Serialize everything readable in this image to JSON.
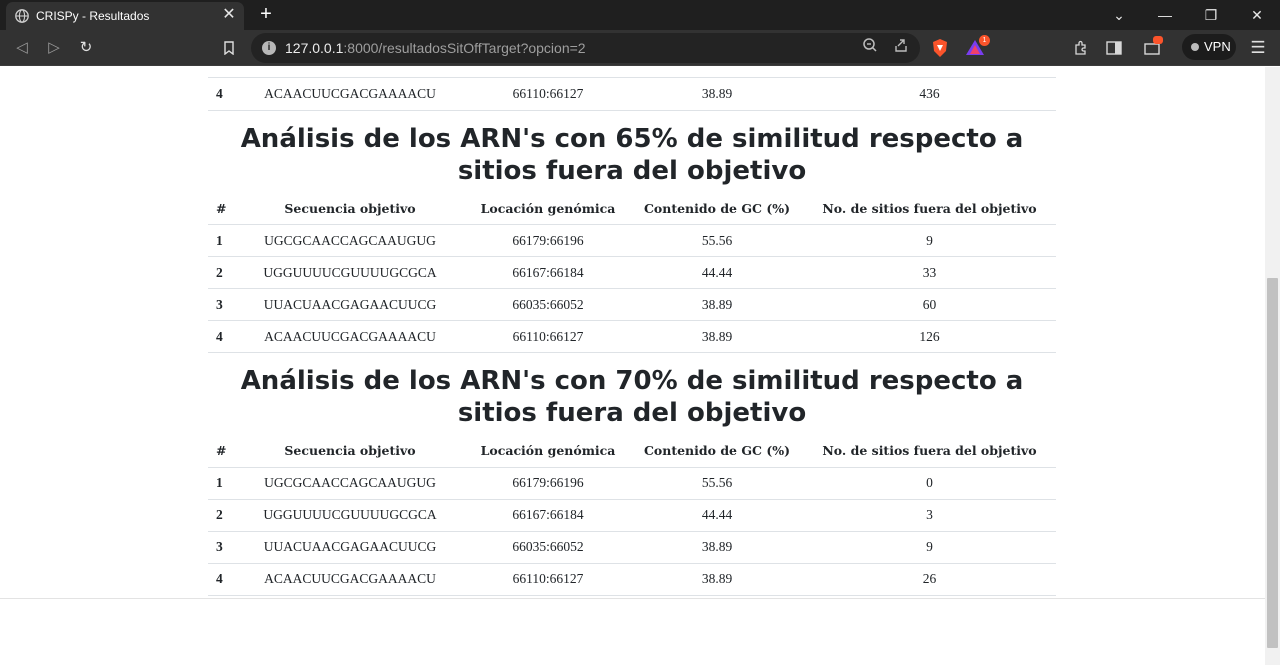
{
  "browser": {
    "tab_title": "CRISPy - Resultados",
    "url_host": "127.0.0.1",
    "url_rest": ":8000/resultadosSitOffTarget?opcion=2",
    "vpn_label": "VPN",
    "brave_alert_count": "1"
  },
  "table_headers": {
    "num": "#",
    "seq": "Secuencia objetivo",
    "loc": "Locación genómica",
    "gc": "Contenido de GC (%)",
    "sites": "No. de sitios fuera del objetivo"
  },
  "partial_row": {
    "num": "4",
    "seq": "ACAACUUCGACGAAAACU",
    "loc": "66110:66127",
    "gc": "38.89",
    "sites": "436"
  },
  "sections": [
    {
      "title": "Análisis de los ARN's con 65% de similitud respecto a sitios fuera del objetivo",
      "rows": [
        {
          "num": "1",
          "seq": "UGCGCAACCAGCAAUGUG",
          "loc": "66179:66196",
          "gc": "55.56",
          "sites": "9"
        },
        {
          "num": "2",
          "seq": "UGGUUUUCGUUUUGCGCA",
          "loc": "66167:66184",
          "gc": "44.44",
          "sites": "33"
        },
        {
          "num": "3",
          "seq": "UUACUAACGAGAACUUCG",
          "loc": "66035:66052",
          "gc": "38.89",
          "sites": "60"
        },
        {
          "num": "4",
          "seq": "ACAACUUCGACGAAAACU",
          "loc": "66110:66127",
          "gc": "38.89",
          "sites": "126"
        }
      ]
    },
    {
      "title": "Análisis de los ARN's con 70% de similitud respecto a sitios fuera del objetivo",
      "rows": [
        {
          "num": "1",
          "seq": "UGCGCAACCAGCAAUGUG",
          "loc": "66179:66196",
          "gc": "55.56",
          "sites": "0"
        },
        {
          "num": "2",
          "seq": "UGGUUUUCGUUUUGCGCA",
          "loc": "66167:66184",
          "gc": "44.44",
          "sites": "3"
        },
        {
          "num": "3",
          "seq": "UUACUAACGAGAACUUCG",
          "loc": "66035:66052",
          "gc": "38.89",
          "sites": "9"
        },
        {
          "num": "4",
          "seq": "ACAACUUCGACGAAAACU",
          "loc": "66110:66127",
          "gc": "38.89",
          "sites": "26"
        }
      ]
    }
  ]
}
